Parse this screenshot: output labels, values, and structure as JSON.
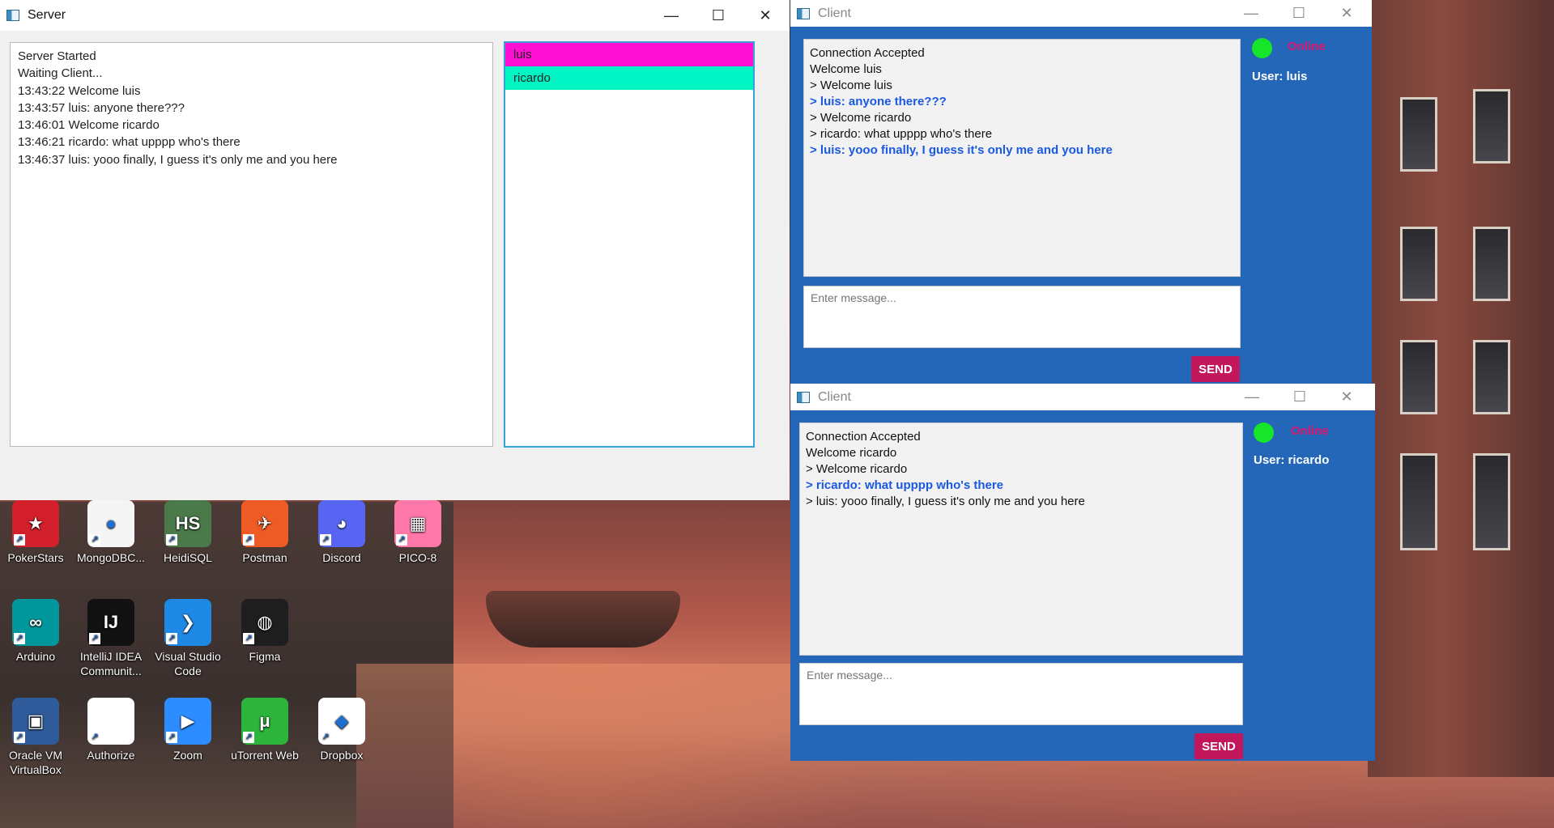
{
  "server": {
    "title": "Server",
    "controls": {
      "minimize": "—",
      "maximize": "☐",
      "close": "✕"
    },
    "log": [
      "Server Started",
      "Waiting Client...",
      "13:43:22 Welcome luis",
      "13:43:57 luis: anyone there???",
      "13:46:01 Welcome ricardo",
      "13:46:21 ricardo: what upppp who's there",
      "13:46:37 luis: yooo finally, I guess it's only me and you here"
    ],
    "users": [
      {
        "name": "luis",
        "color": "#ff10d2"
      },
      {
        "name": "ricardo",
        "color": "#00f5c4"
      }
    ]
  },
  "client_luis": {
    "title": "Client",
    "controls": {
      "minimize": "—",
      "maximize": "☐",
      "close": "✕"
    },
    "chat": [
      {
        "text": "Connection Accepted",
        "bold": false
      },
      {
        "text": "Welcome luis",
        "bold": false
      },
      {
        "text": "> Welcome luis",
        "bold": false
      },
      {
        "text": "> luis: anyone there???",
        "bold": true
      },
      {
        "text": "> Welcome ricardo",
        "bold": false
      },
      {
        "text": "> ricardo: what upppp who's there",
        "bold": false
      },
      {
        "text": "> luis: yooo finally, I guess it's only me and you here",
        "bold": true
      }
    ],
    "input_placeholder": "Enter message...",
    "send_label": "SEND",
    "status": "Online",
    "status_color": "#e0146c",
    "user_label": "User: luis"
  },
  "client_ricardo": {
    "title": "Client",
    "controls": {
      "minimize": "—",
      "maximize": "☐",
      "close": "✕"
    },
    "chat": [
      {
        "text": "Connection Accepted",
        "bold": false
      },
      {
        "text": "Welcome ricardo",
        "bold": false
      },
      {
        "text": "> Welcome ricardo",
        "bold": false
      },
      {
        "text": "> ricardo: what upppp who's there",
        "bold": true
      },
      {
        "text": "> luis: yooo finally, I guess it's only me and you here",
        "bold": false
      }
    ],
    "input_placeholder": "Enter message...",
    "send_label": "SEND",
    "status": "Online",
    "status_color": "#e0146c",
    "user_label": "User: ricardo"
  },
  "desktop_icons": [
    {
      "label": "PokerStars",
      "icon": "pokerstars-icon",
      "color": "#d21f2b"
    },
    {
      "label": "MongoDBC...",
      "icon": "mongodb-compass-icon",
      "color": "#f5f5f5"
    },
    {
      "label": "HeidiSQL",
      "icon": "heidisql-icon",
      "color": "#4a7a4a"
    },
    {
      "label": "Postman",
      "icon": "postman-icon",
      "color": "#ef5b25"
    },
    {
      "label": "Discord",
      "icon": "discord-icon",
      "color": "#5865f2"
    },
    {
      "label": "PICO-8",
      "icon": "pico8-icon",
      "color": "#ff77a8"
    },
    {
      "label": "Arduino",
      "icon": "arduino-icon",
      "color": "#00979c"
    },
    {
      "label": "IntelliJ IDEA Communit...",
      "icon": "intellij-icon",
      "color": "#111111"
    },
    {
      "label": "Visual Studio Code",
      "icon": "vscode-icon",
      "color": "#1e88e5"
    },
    {
      "label": "Figma",
      "icon": "figma-icon",
      "color": "#1e1e1e"
    },
    {
      "label": "Oracle VM VirtualBox",
      "icon": "virtualbox-icon",
      "color": "#2f5b9a"
    },
    {
      "label": "Authorize",
      "icon": "document-icon",
      "color": "#ffffff"
    },
    {
      "label": "Zoom",
      "icon": "zoom-icon",
      "color": "#2d8cff"
    },
    {
      "label": "uTorrent Web",
      "icon": "utorrent-icon",
      "color": "#2db43a"
    },
    {
      "label": "Dropbox",
      "icon": "dropbox-icon",
      "color": "#ffffff"
    }
  ]
}
